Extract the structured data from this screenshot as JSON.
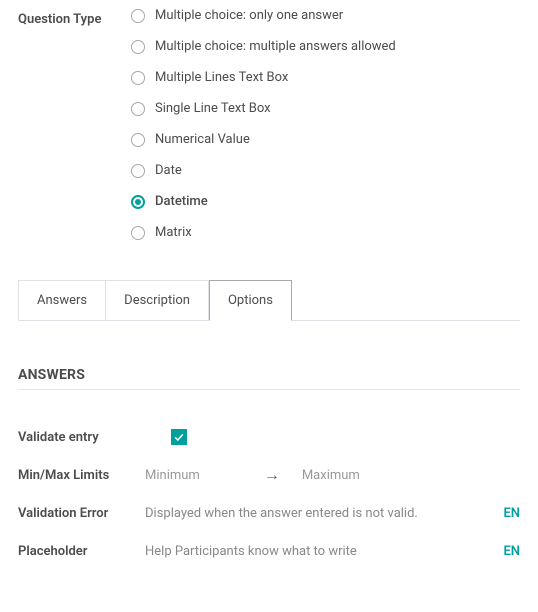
{
  "questionType": {
    "label": "Question Type",
    "options": [
      {
        "label": "Multiple choice: only one answer"
      },
      {
        "label": "Multiple choice: multiple answers allowed"
      },
      {
        "label": "Multiple Lines Text Box"
      },
      {
        "label": "Single Line Text Box"
      },
      {
        "label": "Numerical Value"
      },
      {
        "label": "Date"
      },
      {
        "label": "Datetime"
      },
      {
        "label": "Matrix"
      }
    ],
    "selectedIndex": 6
  },
  "tabs": [
    {
      "label": "Answers"
    },
    {
      "label": "Description"
    },
    {
      "label": "Options"
    }
  ],
  "activeTab": 2,
  "section": {
    "title": "ANSWERS"
  },
  "fields": {
    "validateEntry": {
      "label": "Validate entry",
      "checked": true
    },
    "minMax": {
      "label": "Min/Max Limits",
      "minPlaceholder": "Minimum",
      "maxPlaceholder": "Maximum"
    },
    "validationError": {
      "label": "Validation Error",
      "placeholder": "Displayed when the answer entered is not valid.",
      "lang": "EN"
    },
    "placeholder": {
      "label": "Placeholder",
      "placeholder": "Help Participants know what to write",
      "lang": "EN"
    }
  }
}
